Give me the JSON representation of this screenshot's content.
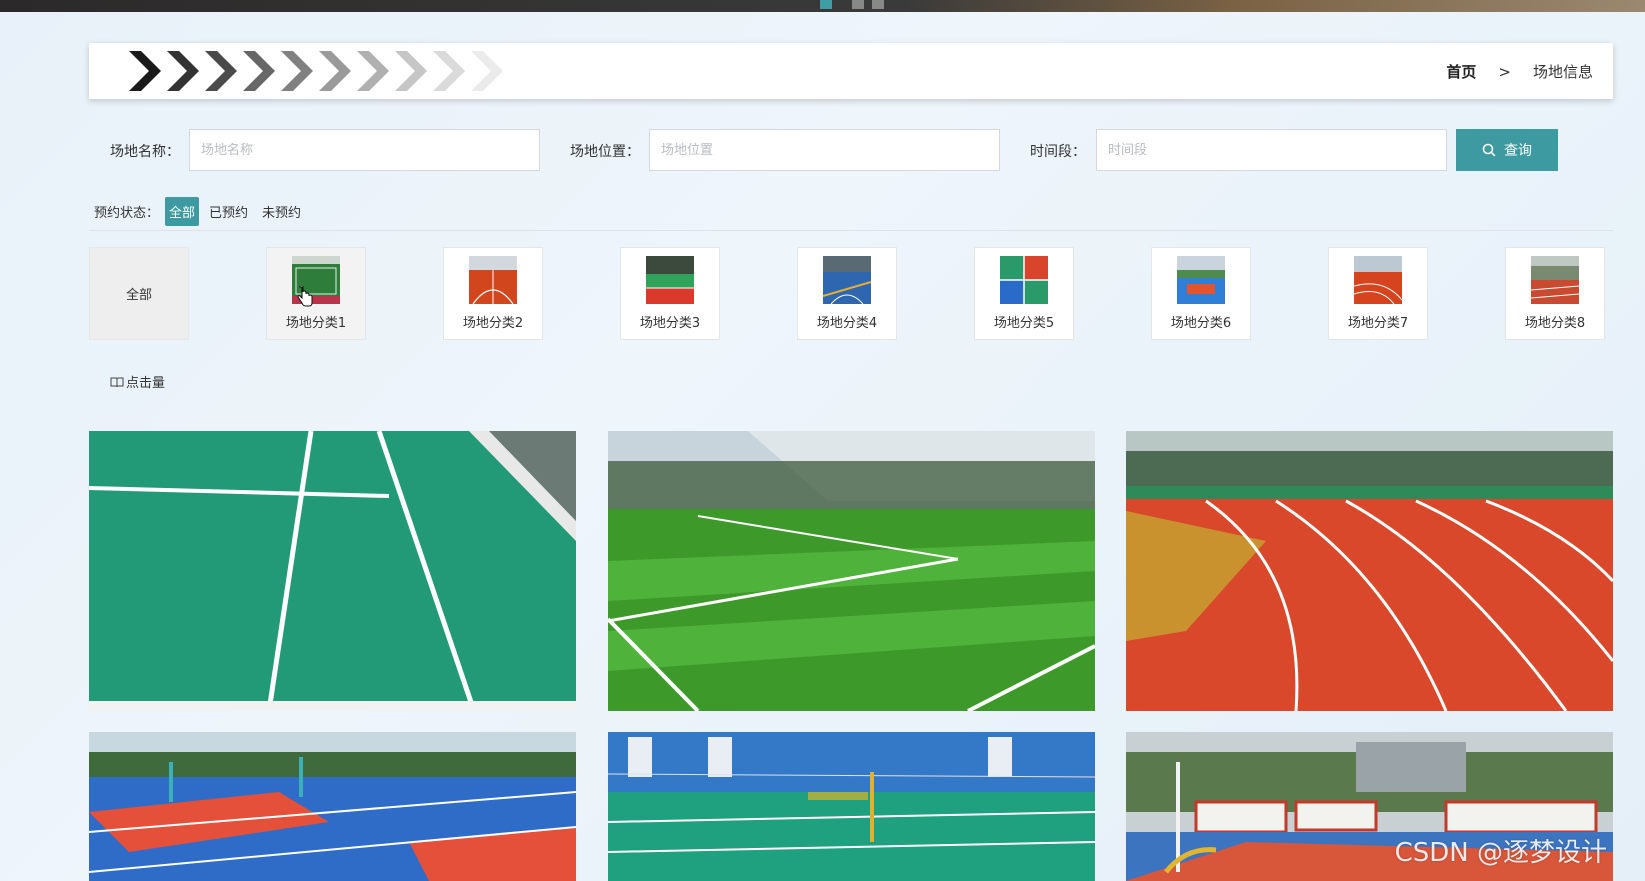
{
  "breadcrumb": {
    "home": "首页",
    "separator": ">",
    "current": "场地信息"
  },
  "search": {
    "name_label": "场地名称：",
    "name_placeholder": "场地名称",
    "location_label": "场地位置：",
    "location_placeholder": "场地位置",
    "time_label": "时间段：",
    "time_placeholder": "时间段",
    "button_label": "查询"
  },
  "status_filter": {
    "label": "预约状态：",
    "options": [
      "全部",
      "已预约",
      "未预约"
    ],
    "selected": "全部"
  },
  "categories": [
    {
      "label": "全部"
    },
    {
      "label": "场地分类1"
    },
    {
      "label": "场地分类2"
    },
    {
      "label": "场地分类3"
    },
    {
      "label": "场地分类4"
    },
    {
      "label": "场地分类5"
    },
    {
      "label": "场地分类6"
    },
    {
      "label": "场地分类7"
    },
    {
      "label": "场地分类8"
    }
  ],
  "sort": {
    "icon": "book-icon",
    "label": "点击量"
  },
  "venue_photos": [
    {
      "scene": "green-court-lines"
    },
    {
      "scene": "soccer-field-turf"
    },
    {
      "scene": "red-running-track"
    },
    {
      "scene": "blue-basketball-courts"
    },
    {
      "scene": "indoor-badminton-hall"
    },
    {
      "scene": "outdoor-court-with-buses"
    }
  ],
  "watermark": "CSDN @逐梦设计",
  "colors": {
    "accent": "#3c9aa0",
    "page_bg": "#eaf2f9"
  }
}
